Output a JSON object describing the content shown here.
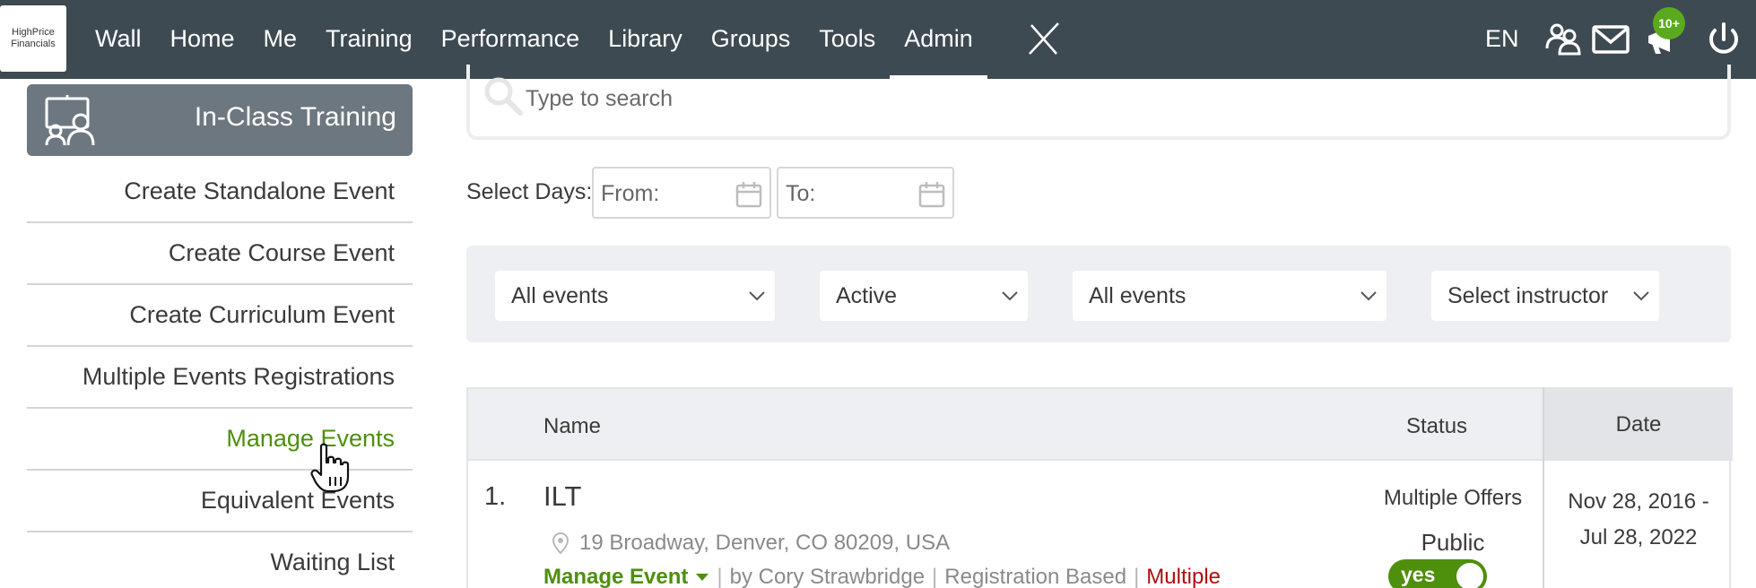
{
  "brand": {
    "logo_line1": "HighPrice",
    "logo_line2": "Financials"
  },
  "nav": {
    "items": [
      "Wall",
      "Home",
      "Me",
      "Training",
      "Performance",
      "Library",
      "Groups",
      "Tools",
      "Admin"
    ],
    "active": "Admin",
    "language": "EN",
    "notifications_badge": "10+"
  },
  "sidebar": {
    "header": "In-Class Training",
    "items": [
      "Create Standalone Event",
      "Create Course Event",
      "Create Curriculum Event",
      "Multiple Events Registrations",
      "Manage Events",
      "Equivalent Events",
      "Waiting List"
    ],
    "active": "Manage Events"
  },
  "search": {
    "placeholder": "Type to search",
    "value": ""
  },
  "date_filter": {
    "label": "Select Days:",
    "from_placeholder": "From:",
    "to_placeholder": "To:"
  },
  "filters": [
    "All events",
    "Active",
    "All events",
    "Select instructor"
  ],
  "table": {
    "headers": {
      "name": "Name",
      "status": "Status",
      "date": "Date"
    },
    "rows": [
      {
        "index": "1.",
        "title": "ILT",
        "address": "19 Broadway, Denver, CO 80209, USA",
        "manage_label": "Manage Event",
        "owner": "by Cory Strawbridge",
        "registration": "Registration Based",
        "multiple_label": "Multiple",
        "status_offers": "Multiple Offers",
        "public_label": "Public",
        "public_value": "yes",
        "date_line1": "Nov 28, 2016 -",
        "date_line2": "Jul 28, 2022"
      }
    ]
  },
  "colors": {
    "topbar": "#3e4a52",
    "accent_green": "#4e8f0c",
    "badge_green": "#5aaa1e",
    "sidebar_header": "#6d7780",
    "alert_red": "#b00e0e"
  }
}
